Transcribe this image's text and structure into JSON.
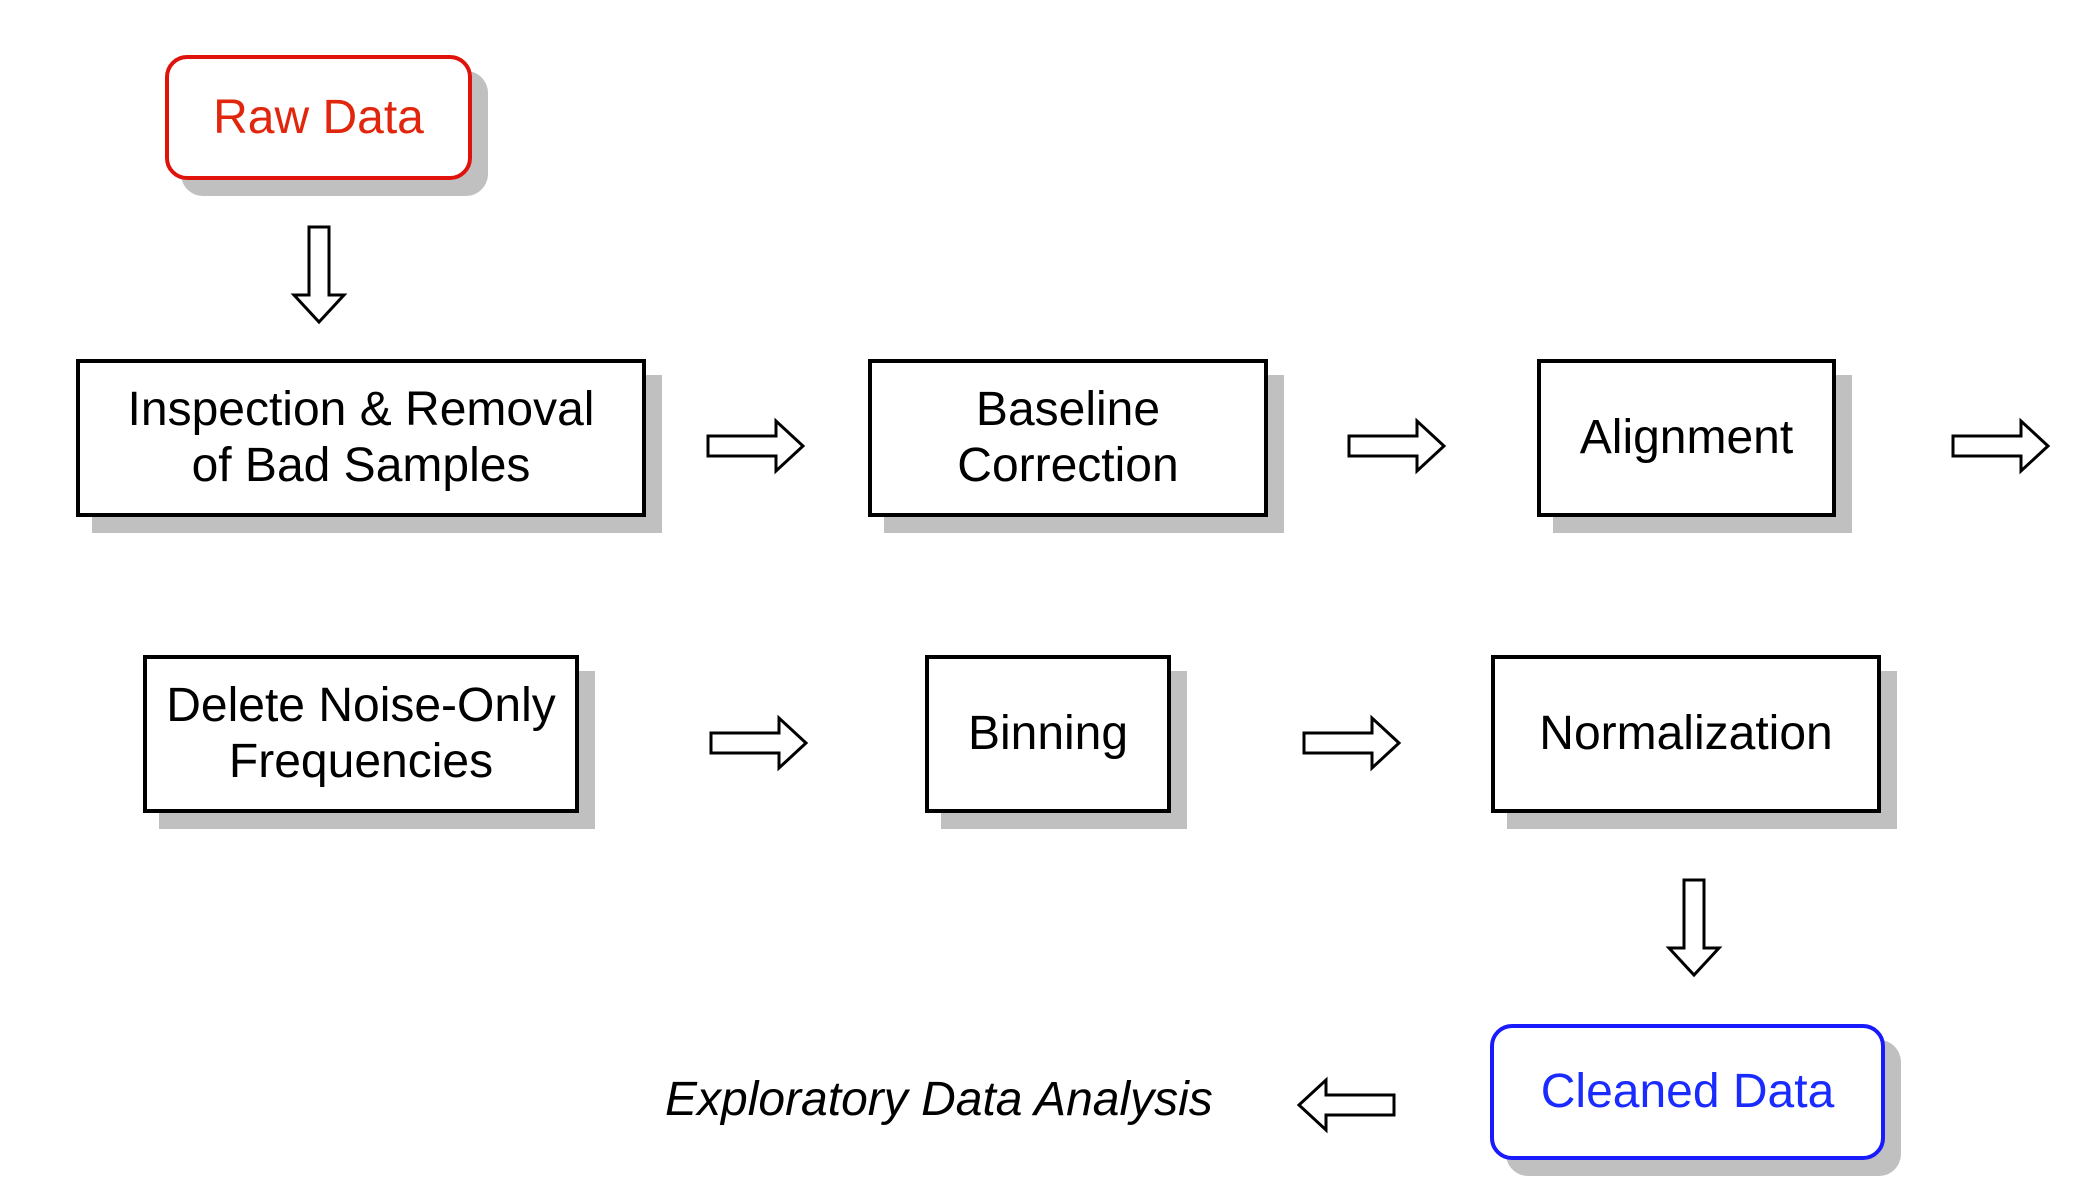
{
  "nodes": {
    "raw_data": "Raw Data",
    "inspection_line1": "Inspection & Removal",
    "inspection_line2": "of Bad Samples",
    "baseline_line1": "Baseline",
    "baseline_line2": "Correction",
    "alignment": "Alignment",
    "delete_line1": "Delete Noise-Only",
    "delete_line2": "Frequencies",
    "binning": "Binning",
    "normalization": "Normalization",
    "cleaned_data": "Cleaned Data",
    "eda": "Exploratory Data Analysis"
  },
  "colors": {
    "start": "#e0120c",
    "end": "#1a1aff",
    "shadow": "#c0c0c0"
  }
}
